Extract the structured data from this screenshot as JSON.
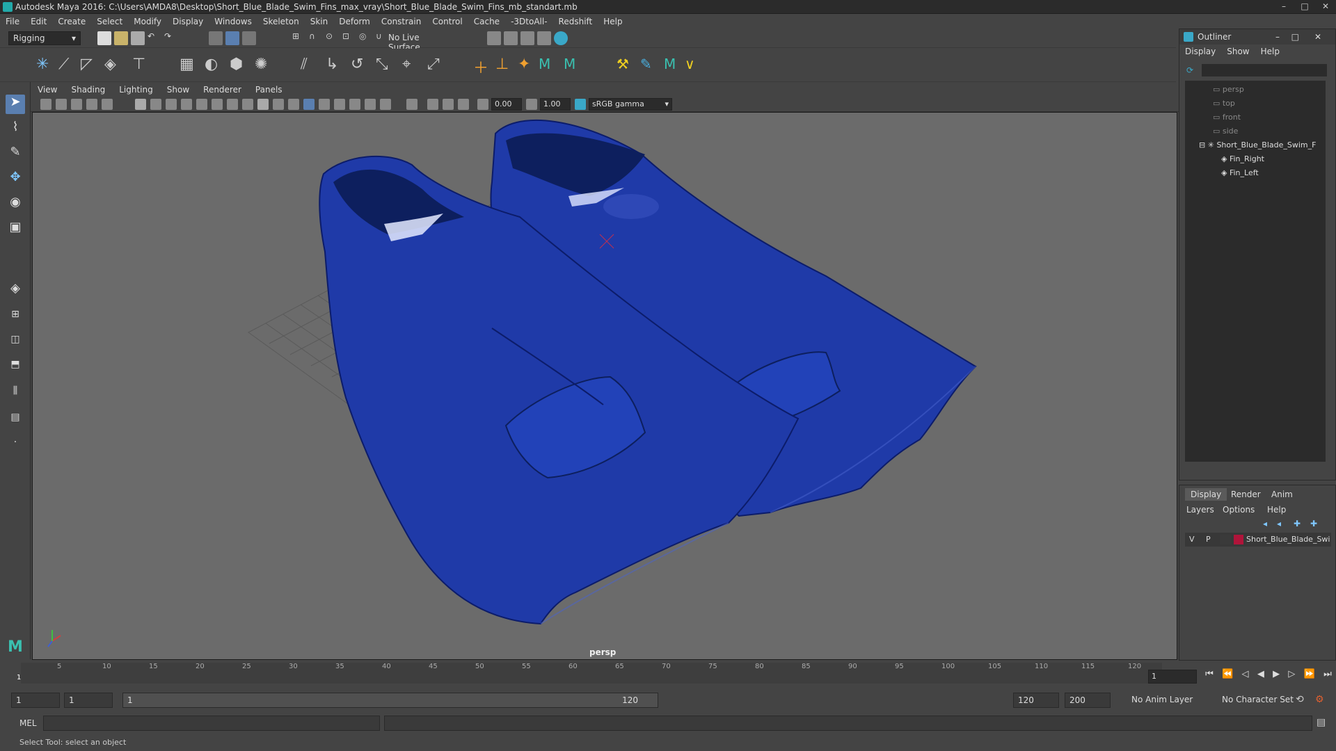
{
  "window": {
    "title": "Autodesk Maya 2016: C:\\Users\\AMDA8\\Desktop\\Short_Blue_Blade_Swim_Fins_max_vray\\Short_Blue_Blade_Swim_Fins_mb_standart.mb",
    "minimize": "–",
    "maximize": "□",
    "close": "✕"
  },
  "menubar": [
    "File",
    "Edit",
    "Create",
    "Select",
    "Modify",
    "Display",
    "Windows",
    "Skeleton",
    "Skin",
    "Deform",
    "Constrain",
    "Control",
    "Cache",
    "-3DtoAll-",
    "Redshift",
    "Help"
  ],
  "statusline": {
    "mode": "Rigging",
    "live_surface": "No Live Surface"
  },
  "panel": {
    "menus": [
      "View",
      "Shading",
      "Lighting",
      "Show",
      "Renderer",
      "Panels"
    ],
    "near_clip": "0.00",
    "far_clip": "1.00",
    "color_space": "sRGB gamma",
    "camera": "persp"
  },
  "timeline": {
    "ticks": [
      "5",
      "10",
      "15",
      "20",
      "25",
      "30",
      "35",
      "40",
      "45",
      "50",
      "55",
      "60",
      "65",
      "70",
      "75",
      "80",
      "85",
      "90",
      "95",
      "100",
      "105",
      "110",
      "115",
      "120"
    ],
    "start_marker": "1",
    "current_frame": "1"
  },
  "range": {
    "start": "1",
    "playback_start": "1",
    "slider_start": "1",
    "slider_end": "120",
    "playback_end": "120",
    "end": "200",
    "anim_layer": "No Anim Layer",
    "character_set": "No Character Set"
  },
  "command": {
    "language": "MEL"
  },
  "help_line": "Select Tool: select an object",
  "outliner": {
    "title": "Outliner",
    "menus": [
      "Display",
      "Show",
      "Help"
    ],
    "cameras": [
      "persp",
      "top",
      "front",
      "side"
    ],
    "group": "Short_Blue_Blade_Swim_F",
    "children": [
      "Fin_Right",
      "Fin_Left"
    ]
  },
  "channel": {
    "tabs": [
      "Display",
      "Render",
      "Anim"
    ],
    "menus": [
      "Layers",
      "Options",
      "Help"
    ],
    "layer": {
      "v": "V",
      "p": "P",
      "name": "Short_Blue_Blade_Swi",
      "color": "#b0143a"
    }
  },
  "colors": {
    "fin_blue": "#1f3aa8",
    "viewport_bg": "#6b6b6b"
  }
}
